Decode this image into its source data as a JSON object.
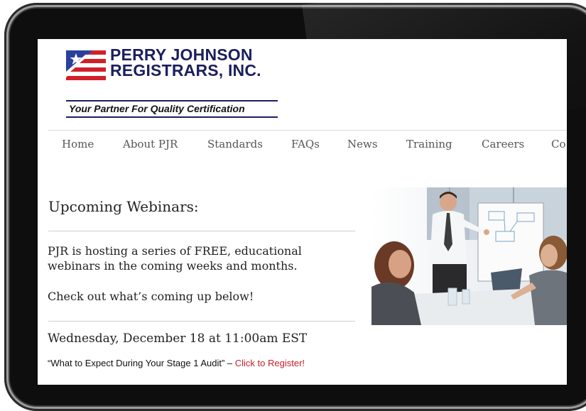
{
  "logo": {
    "line1": "PERRY JOHNSON",
    "line2": "REGISTRARS, INC.",
    "tagline": "Your Partner For Quality Certification",
    "colors": {
      "navy": "#1b1f5e",
      "red": "#d0202a",
      "blue": "#2b3f9c"
    }
  },
  "nav": {
    "items": [
      "Home",
      "About PJR",
      "Standards",
      "FAQs",
      "News",
      "Training",
      "Careers",
      "Co"
    ]
  },
  "main": {
    "heading": "Upcoming Webinars:",
    "intro_line1": "PJR is hosting a series of FREE, educational",
    "intro_line2": "webinars in the coming weeks and months.",
    "check_out": "Check out what’s coming up below!",
    "event_date": "Wednesday, December 18 at 11:00am EST",
    "event_title": "“What to Expect During Your Stage 1 Audit” – ",
    "register_link": "Click to Register!",
    "link_color": "#c7202a"
  },
  "photo": {
    "alt_icon": "business-meeting-photo"
  }
}
